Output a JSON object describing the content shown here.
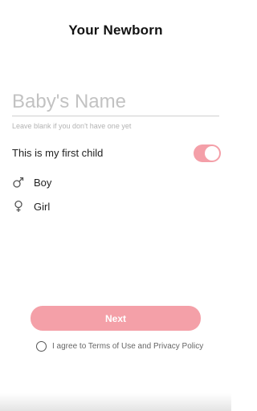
{
  "header": {
    "title": "Your Newborn"
  },
  "name_field": {
    "placeholder": "Baby's Name",
    "hint": "Leave blank if you don't have one yet"
  },
  "first_child": {
    "label": "This is my first child",
    "enabled": true,
    "accent_color": "#f49fa8"
  },
  "gender_options": [
    {
      "label": "Boy",
      "icon": "male-symbol-icon"
    },
    {
      "label": "Girl",
      "icon": "female-symbol-icon"
    }
  ],
  "next_button": {
    "label": "Next",
    "color": "#f4a0a8"
  },
  "agreement": {
    "text": "I agree to Terms of Use and Privacy Policy",
    "checked": false
  }
}
